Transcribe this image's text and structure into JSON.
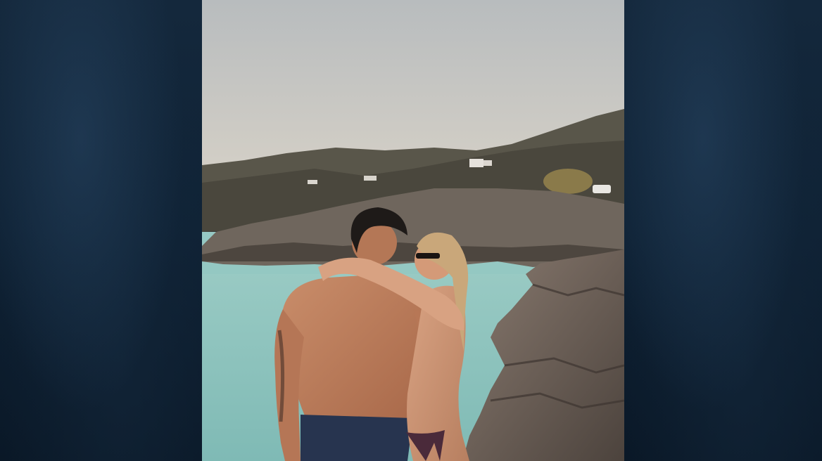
{
  "scene": {
    "description_visible_text": "",
    "colors": {
      "backdrop": "#0d1c2c",
      "sky_top": "#b9bcbd",
      "sky_bottom": "#d4d0c6",
      "sea": "#8cc3bf",
      "rock": "#6d6259",
      "hill": "#4d4a40"
    }
  }
}
